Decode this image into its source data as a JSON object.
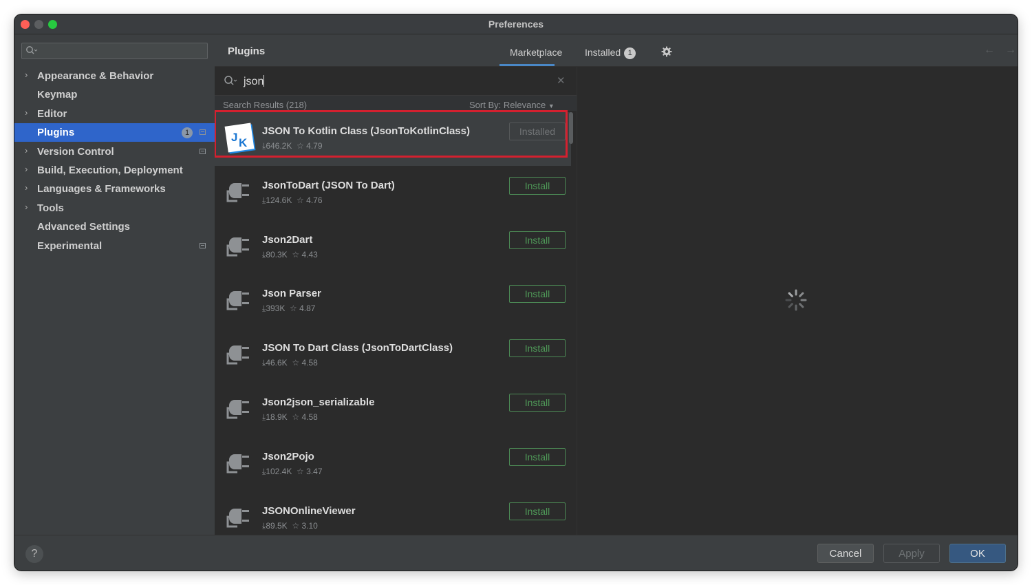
{
  "window": {
    "title": "Preferences"
  },
  "sidebar": {
    "search_placeholder": "",
    "items": [
      {
        "label": "Appearance & Behavior",
        "expandable": true
      },
      {
        "label": "Keymap",
        "expandable": false
      },
      {
        "label": "Editor",
        "expandable": true
      },
      {
        "label": "Plugins",
        "expandable": false,
        "selected": true,
        "badge": "1"
      },
      {
        "label": "Version Control",
        "expandable": true
      },
      {
        "label": "Build, Execution, Deployment",
        "expandable": true
      },
      {
        "label": "Languages & Frameworks",
        "expandable": true
      },
      {
        "label": "Tools",
        "expandable": true
      },
      {
        "label": "Advanced Settings",
        "expandable": false
      },
      {
        "label": "Experimental",
        "expandable": false
      }
    ]
  },
  "header": {
    "title": "Plugins",
    "tabs": [
      {
        "label": "Marketplace",
        "active": true
      },
      {
        "label": "Installed",
        "badge": "1"
      }
    ],
    "settings_icon": "gear-icon",
    "back_icon": "arrow-left-icon",
    "forward_icon": "arrow-right-icon"
  },
  "search": {
    "query": "json"
  },
  "results": {
    "count_label": "Search Results (218)",
    "sort_label": "Sort By: Relevance"
  },
  "plugins": [
    {
      "name": "JSON To Kotlin Class (JsonToKotlinClass)",
      "downloads": "646.2K",
      "rating": "4.79",
      "button": "Installed"
    },
    {
      "name": "JsonToDart (JSON To Dart)",
      "downloads": "124.6K",
      "rating": "4.76",
      "button": "Install"
    },
    {
      "name": "Json2Dart",
      "downloads": "80.3K",
      "rating": "4.43",
      "button": "Install"
    },
    {
      "name": "Json Parser",
      "downloads": "393K",
      "rating": "4.87",
      "button": "Install"
    },
    {
      "name": "JSON To Dart Class (JsonToDartClass)",
      "downloads": "46.6K",
      "rating": "4.58",
      "button": "Install"
    },
    {
      "name": "Json2json_serializable",
      "downloads": "18.9K",
      "rating": "4.58",
      "button": "Install"
    },
    {
      "name": "Json2Pojo",
      "downloads": "102.4K",
      "rating": "3.47",
      "button": "Install"
    },
    {
      "name": "JSONOnlineViewer",
      "downloads": "89.5K",
      "rating": "3.10",
      "button": "Install"
    }
  ],
  "footer": {
    "help": "?",
    "cancel": "Cancel",
    "apply": "Apply",
    "ok": "OK"
  },
  "colors": {
    "selection": "#2f65ca",
    "highlight_box": "#d4202f",
    "install_green": "#4f9a58"
  }
}
